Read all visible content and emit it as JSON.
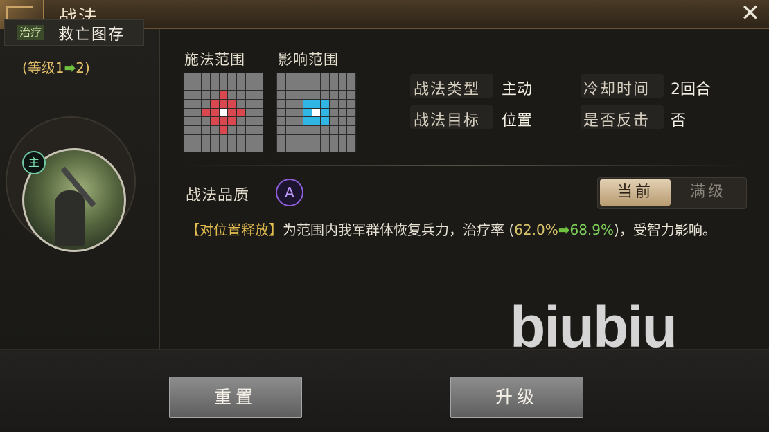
{
  "window": {
    "title": "战法"
  },
  "skill": {
    "tag": "治疗",
    "name": "救亡图存",
    "level_text": "(等级1",
    "level_arrow": "➡",
    "level_next": "2)",
    "badge": "主"
  },
  "ranges": {
    "cast_label": "施法范围",
    "effect_label": "影响范围"
  },
  "info": {
    "type_label": "战法类型",
    "type_value": "主动",
    "cooldown_label": "冷却时间",
    "cooldown_value": "2回合",
    "target_label": "战法目标",
    "target_value": "位置",
    "counter_label": "是否反击",
    "counter_value": "否"
  },
  "quality": {
    "label": "战法品质",
    "grade": "A"
  },
  "toggle": {
    "current": "当前",
    "max": "满级"
  },
  "description": {
    "prefix": "【对位置释放】",
    "text": "为范围内我军群体恢复兵力，治疗率 (",
    "current_rate": "62.0%",
    "arrow": "➡",
    "next_rate": "68.9%",
    "suffix": ")，受智力影响。"
  },
  "watermark": "biubiu",
  "buttons": {
    "reset": "重置",
    "upgrade": "升级"
  },
  "colors": {
    "cast_range": "#d9484f",
    "effect_range": "#2fb6e5",
    "quality": "#8d5fd6"
  }
}
